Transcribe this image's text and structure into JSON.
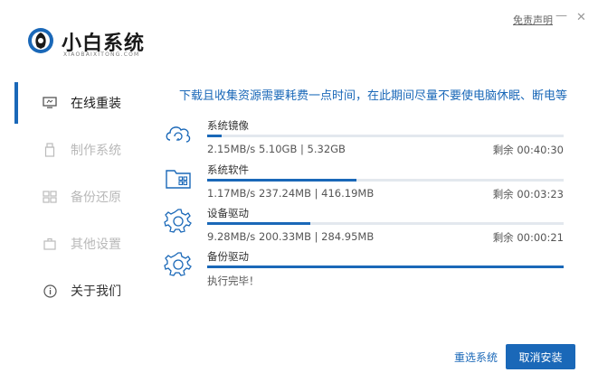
{
  "header": {
    "brand_name": "小白系统",
    "brand_sub": "XIAOBAIXITONG.COM",
    "disclaimer": "免责声明",
    "minimize": "—",
    "close": "✕"
  },
  "sidebar": {
    "items": [
      {
        "label": "在线重装",
        "icon": "monitor-icon",
        "state": "active"
      },
      {
        "label": "制作系统",
        "icon": "usb-icon",
        "state": "disabled"
      },
      {
        "label": "备份还原",
        "icon": "backup-icon",
        "state": "disabled"
      },
      {
        "label": "其他设置",
        "icon": "settings-icon",
        "state": "disabled"
      },
      {
        "label": "关于我们",
        "icon": "info-icon",
        "state": "normal"
      }
    ]
  },
  "main": {
    "notice": "下载且收集资源需要耗费一点时间，在此期间尽量不要使电脑休眠、断电等",
    "tasks": [
      {
        "name": "系统镜像",
        "icon": "cloud-refresh-icon",
        "progress": 0.04,
        "stats": "2.15MB/s 5.10GB | 5.32GB",
        "remaining": "剩余 00:40:30"
      },
      {
        "name": "系统软件",
        "icon": "folder-apps-icon",
        "progress": 0.42,
        "stats": "1.17MB/s 237.24MB | 416.19MB",
        "remaining": "剩余 00:03:23"
      },
      {
        "name": "设备驱动",
        "icon": "gear-icon",
        "progress": 0.29,
        "stats": "9.28MB/s 200.33MB | 284.95MB",
        "remaining": "剩余 00:00:21"
      },
      {
        "name": "备份驱动",
        "icon": "gear-icon",
        "progress": 1.0,
        "stats": "执行完毕！",
        "remaining": ""
      }
    ]
  },
  "footer": {
    "reselect_label": "重选系统",
    "cancel_label": "取消安装"
  },
  "colors": {
    "accent": "#1a68b8",
    "track": "#e3e8ee",
    "disabled_text": "#b9b9b9"
  }
}
